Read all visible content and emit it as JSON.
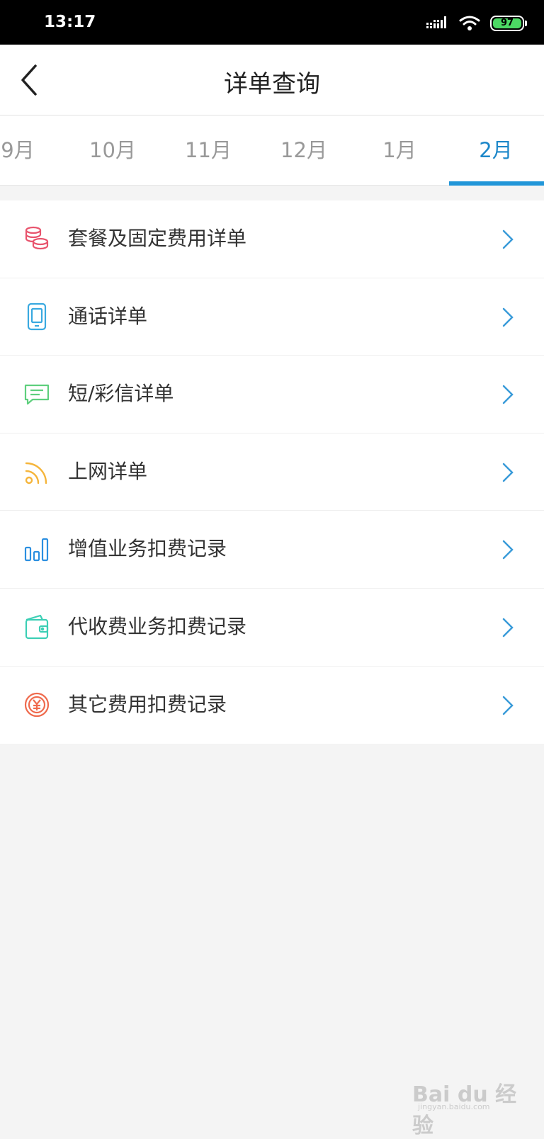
{
  "status_bar": {
    "time": "13:17",
    "battery": "97"
  },
  "header": {
    "title": "详单查询"
  },
  "tabs": [
    {
      "label": "9月"
    },
    {
      "label": "10月"
    },
    {
      "label": "11月"
    },
    {
      "label": "12月"
    },
    {
      "label": "1月"
    },
    {
      "label": "2月",
      "active": true
    }
  ],
  "menu": [
    {
      "label": "套餐及固定费用详单",
      "icon": "coins-icon",
      "color": "#e8546d"
    },
    {
      "label": "通话详单",
      "icon": "phone-icon",
      "color": "#39a9e0"
    },
    {
      "label": "短/彩信详单",
      "icon": "message-icon",
      "color": "#5ecf7d"
    },
    {
      "label": "上网详单",
      "icon": "rss-icon",
      "color": "#f5b53b"
    },
    {
      "label": "增值业务扣费记录",
      "icon": "bar-chart-icon",
      "color": "#2b8fe0"
    },
    {
      "label": "代收费业务扣费记录",
      "icon": "wallet-icon",
      "color": "#3ccfb5"
    },
    {
      "label": "其它费用扣费记录",
      "icon": "yuan-coin-icon",
      "color": "#ef6a4d"
    }
  ],
  "watermark": {
    "main": "Bai du 经验",
    "sub": "jingyan.baidu.com"
  }
}
